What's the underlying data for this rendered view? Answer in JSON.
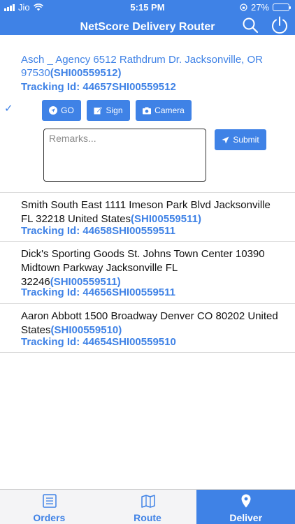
{
  "status": {
    "carrier": "Jio",
    "time": "5:15 PM",
    "battery": "27%",
    "battery_level": 0.27
  },
  "header": {
    "title": "NetScore Delivery Router"
  },
  "active_order": {
    "address": "Asch _ Agency 6512 Rathdrum Dr. Jacksonville, OR 97530",
    "shipment": "(SHI00559512)",
    "tracking": "Tracking Id: 44657SHI00559512",
    "buttons": {
      "go": "GO",
      "sign": "Sign",
      "camera": "Camera",
      "submit": "Submit"
    },
    "remarks_placeholder": "Remarks..."
  },
  "orders": [
    {
      "address": "Smith South East 1111 Imeson Park Blvd Jacksonville FL 32218 United States",
      "shipment": "(SHI00559511)",
      "tracking": "Tracking Id: 44658SHI00559511"
    },
    {
      "address": "Dick's Sporting Goods St. Johns Town Center 10390 Midtown Parkway Jacksonville FL 32246",
      "shipment": "(SHI00559511)",
      "tracking": "Tracking Id: 44656SHI00559511"
    },
    {
      "address": "Aaron Abbott 1500 Broadway Denver CO 80202 United States",
      "shipment": "(SHI00559510)",
      "tracking": "Tracking Id: 44654SHI00559510"
    }
  ],
  "tabs": [
    {
      "label": "Orders",
      "icon": "list-icon"
    },
    {
      "label": "Route",
      "icon": "map-icon"
    },
    {
      "label": "Deliver",
      "icon": "map-pin-icon"
    }
  ],
  "colors": {
    "accent": "#3f82e6"
  }
}
